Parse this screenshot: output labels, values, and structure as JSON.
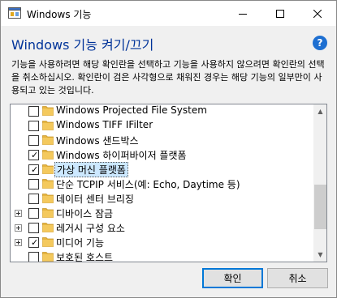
{
  "window": {
    "title": "Windows 기능",
    "minimize_icon": "minimize-icon",
    "maximize_icon": "maximize-icon",
    "close_icon": "close-icon"
  },
  "header": {
    "heading": "Windows 기능 켜기/끄기",
    "help_symbol": "?",
    "description": "기능을 사용하려면 해당 확인란을 선택하고 기능을 사용하지 않으려면 확인란의 선택을 취소하십시오. 확인란이 검은 사각형으로 채워진 경우는 해당 기능의 일부만이 사용되고 있는 것입니다."
  },
  "features": [
    {
      "label": "Windows Projected File System",
      "checked": false,
      "expandable": false,
      "selected": false
    },
    {
      "label": "Windows TIFF IFilter",
      "checked": false,
      "expandable": false,
      "selected": false
    },
    {
      "label": "Windows 샌드박스",
      "checked": false,
      "expandable": false,
      "selected": false
    },
    {
      "label": "Windows 하이퍼바이저 플랫폼",
      "checked": true,
      "expandable": false,
      "selected": false
    },
    {
      "label": "가상 머신 플랫폼",
      "checked": true,
      "expandable": false,
      "selected": true
    },
    {
      "label": "단순 TCPIP 서비스(예: Echo, Daytime 등)",
      "checked": false,
      "expandable": false,
      "selected": false
    },
    {
      "label": "데이터 센터 브리징",
      "checked": false,
      "expandable": false,
      "selected": false
    },
    {
      "label": "디바이스 잠금",
      "checked": false,
      "expandable": true,
      "selected": false
    },
    {
      "label": "레거시 구성 요소",
      "checked": false,
      "expandable": true,
      "selected": false
    },
    {
      "label": "미디어 기능",
      "checked": true,
      "expandable": true,
      "selected": false
    },
    {
      "label": "보호된 호스트",
      "checked": false,
      "expandable": false,
      "selected": false
    }
  ],
  "buttons": {
    "ok": "확인",
    "cancel": "취소"
  },
  "colors": {
    "heading": "#003399",
    "folder": "#f4c95d",
    "accent": "#0078d7"
  }
}
